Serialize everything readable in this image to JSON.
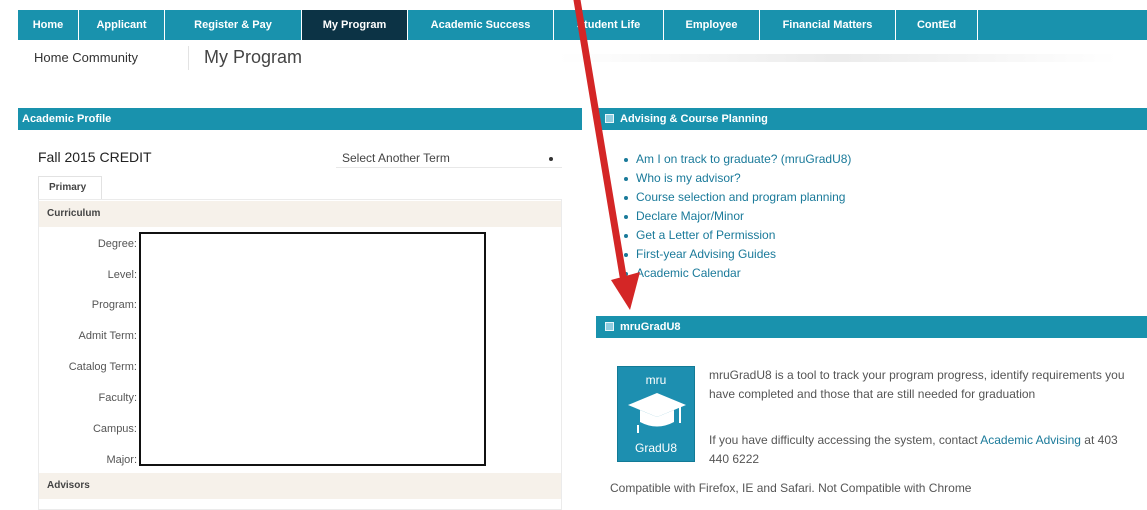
{
  "topnav": {
    "items": [
      {
        "label": "Home",
        "active": false
      },
      {
        "label": "Applicant",
        "active": false
      },
      {
        "label": "Register & Pay",
        "active": false
      },
      {
        "label": "My Program",
        "active": true
      },
      {
        "label": "Academic Success",
        "active": false
      },
      {
        "label": "Student Life",
        "active": false
      },
      {
        "label": "Employee",
        "active": false
      },
      {
        "label": "Financial Matters",
        "active": false
      },
      {
        "label": "ContEd",
        "active": false
      }
    ]
  },
  "subnav": {
    "home_community": "Home Community",
    "page_title": "My Program"
  },
  "academic_profile": {
    "header": "Academic Profile",
    "term": "Fall 2015 CREDIT",
    "term_select": "Select Another Term",
    "tab": "Primary",
    "curriculum_label": "Curriculum",
    "fields": [
      "Degree:",
      "Level:",
      "Program:",
      "Admit Term:",
      "Catalog Term:",
      "Faculty:",
      "Campus:",
      "Major:"
    ],
    "advisors_label": "Advisors"
  },
  "advising": {
    "header": "Advising & Course Planning",
    "links": [
      "Am I on track to graduate? (mruGradU8)",
      "Who is my advisor?",
      "Course selection and program planning",
      "Declare Major/Minor",
      "Get a Letter of Permission",
      "First-year Advising Guides",
      "Academic Calendar"
    ]
  },
  "gradu8": {
    "header": "mruGradU8",
    "logo_top": "mru",
    "logo_bottom": "GradU8",
    "description": "mruGradU8 is a tool to track your program progress, identify requirements you have completed and those that are still needed for graduation",
    "contact_prefix": "If you have difficulty accessing the system, contact ",
    "contact_link": "Academic Advising",
    "contact_suffix": " at 403 440 6222",
    "compatibility": "Compatible with Firefox, IE and Safari. Not Compatible with Chrome"
  },
  "colors": {
    "nav_bg": "#1992ad",
    "nav_active_bg": "#0c3345",
    "link": "#1a7a9a",
    "annotation_arrow": "#d42626"
  }
}
